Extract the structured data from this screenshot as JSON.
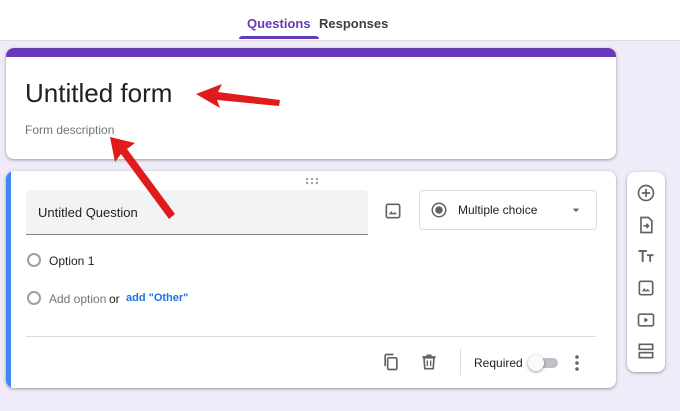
{
  "tabs": [
    {
      "label": "Questions",
      "active": true
    },
    {
      "label": "Responses",
      "active": false
    }
  ],
  "form": {
    "title": "Untitled form",
    "description_placeholder": "Form description"
  },
  "question": {
    "title": "Untitled Question",
    "type": "Multiple choice",
    "options": [
      "Option 1"
    ],
    "add_option_label": "Add option",
    "or_label": "or",
    "add_other_label": "add \"Other\"",
    "required_label": "Required",
    "required": false
  },
  "side_toolbar": {
    "items": [
      "add-question-icon",
      "import-questions-icon",
      "add-title-icon",
      "add-image-icon",
      "add-video-icon",
      "add-section-icon"
    ]
  },
  "colors": {
    "brand": "#673ab7",
    "accent": "#4285f4",
    "link": "#1a73e8",
    "annotation_arrow": "#e01b1b"
  }
}
